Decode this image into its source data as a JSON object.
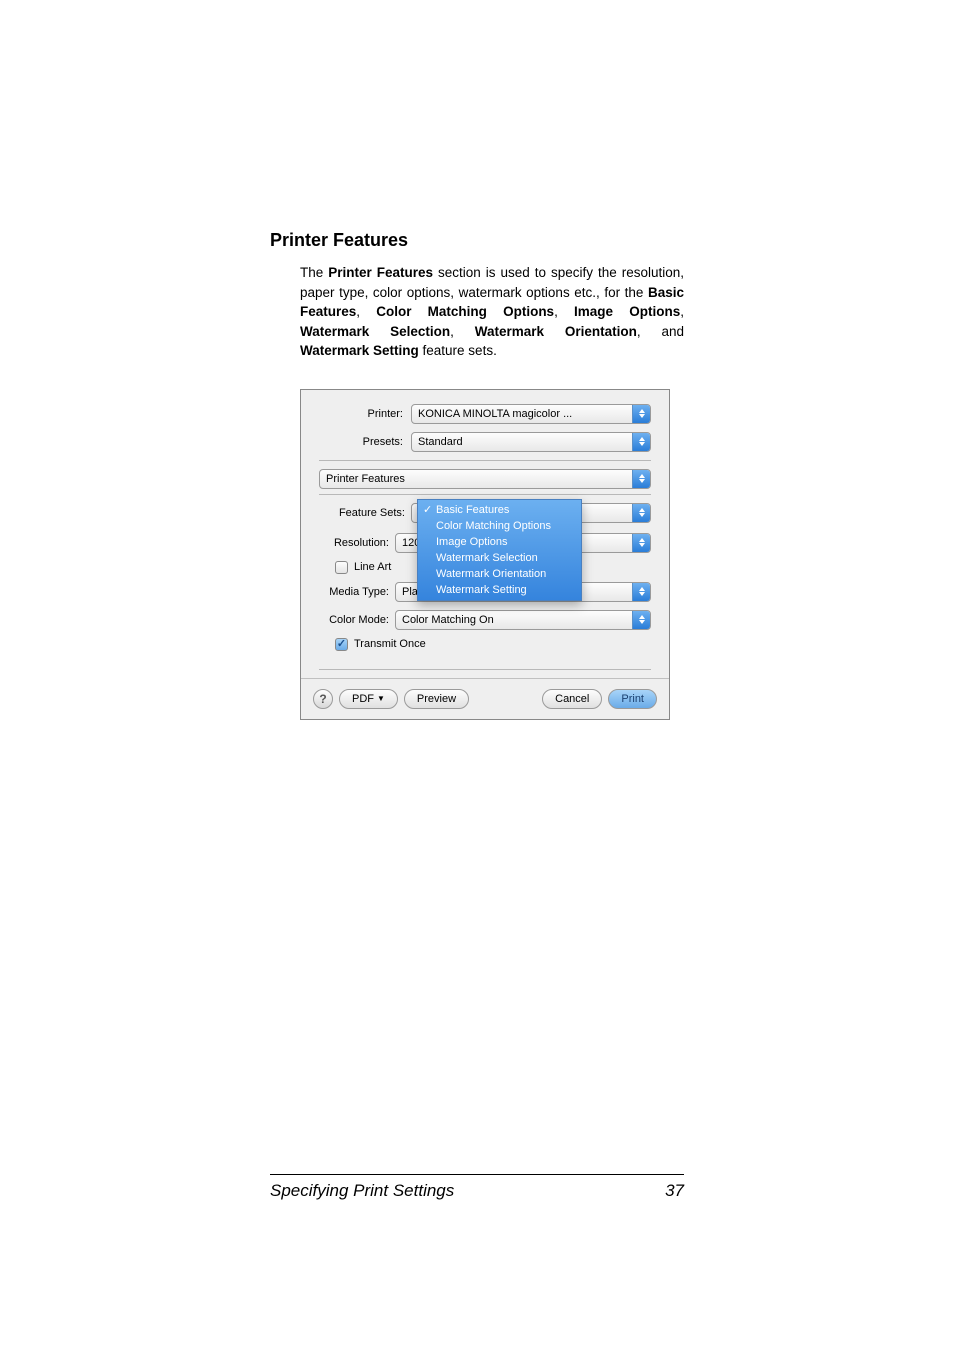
{
  "section": {
    "title": "Printer Features",
    "paragraph_parts": {
      "p1": "The ",
      "b1": "Printer Features",
      "p2": " section is used to specify the resolution, paper type, color options, watermark options etc., for the ",
      "b2": "Basic Features",
      "p3": ", ",
      "b3": "Color Matching Options",
      "p4": ", ",
      "b4": "Image Options",
      "p5": ", ",
      "b5": "Watermark Selection",
      "p6": ", ",
      "b6": "Watermark Orientation",
      "p7": ", and ",
      "b7": "Watermark Setting",
      "p8": " feature sets."
    }
  },
  "dialog": {
    "printer_label": "Printer:",
    "printer_value": "KONICA MINOLTA magicolor ...",
    "presets_label": "Presets:",
    "presets_value": "Standard",
    "pane_value": "Printer Features",
    "feature_sets_label": "Feature Sets:",
    "feature_sets_value": "Basic Features",
    "feature_sets_menu": [
      "Basic Features",
      "Color Matching Options",
      "Image Options",
      "Watermark Selection",
      "Watermark Orientation",
      "Watermark Setting"
    ],
    "resolution_label": "Resolution:",
    "resolution_value": "1200x600 D",
    "lineart_label": "Line Art",
    "mediatype_label": "Media Type:",
    "mediatype_value": "Plain Paper",
    "colormode_label": "Color Mode:",
    "colormode_value": "Color Matching On",
    "transmit_label": "Transmit Once",
    "buttons": {
      "help": "?",
      "pdf": "PDF",
      "preview": "Preview",
      "cancel": "Cancel",
      "print": "Print"
    }
  },
  "footer": {
    "title": "Specifying Print Settings",
    "page": "37"
  }
}
